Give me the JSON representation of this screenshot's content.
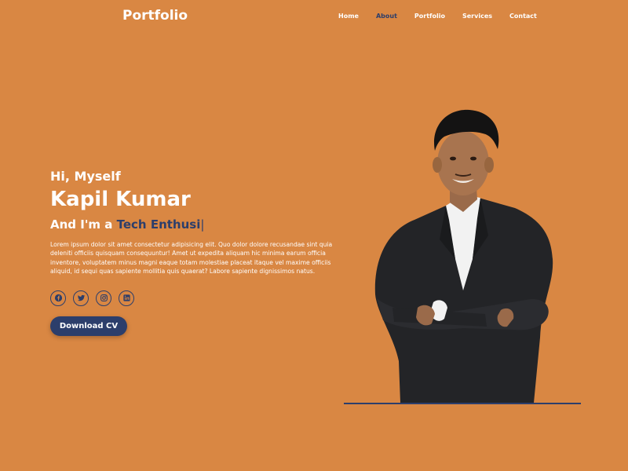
{
  "navbar": {
    "logo": "Portfolio",
    "links": [
      {
        "label": "Home",
        "active": false
      },
      {
        "label": "About",
        "active": true
      },
      {
        "label": "Portfolio",
        "active": false
      },
      {
        "label": "Services",
        "active": false
      },
      {
        "label": "Contact",
        "active": false
      }
    ]
  },
  "hero": {
    "greeting": "Hi, Myself",
    "name": "Kapil Kumar",
    "role_prefix": "And I'm a ",
    "role_typed": "Tech Enthusi",
    "cursor": "|",
    "bio": "Lorem ipsum dolor sit amet consectetur adipisicing elit. Quo dolor dolore recusandae sint quia deleniti officiis quisquam consequuntur! Amet ut expedita aliquam hic minima earum officia inventore, voluptatem minus magni eaque totam molestiae placeat itaque vel maxime officiis aliquid, id sequi quas sapiente mollitia quis quaerat? Labore sapiente dignissimos natus.",
    "socials": [
      "facebook-icon",
      "twitter-icon",
      "instagram-icon",
      "linkedin-icon"
    ],
    "cv_button": "Download CV"
  },
  "colors": {
    "background": "#d98743",
    "accent": "#2c3e6b",
    "text": "#ffffff"
  }
}
